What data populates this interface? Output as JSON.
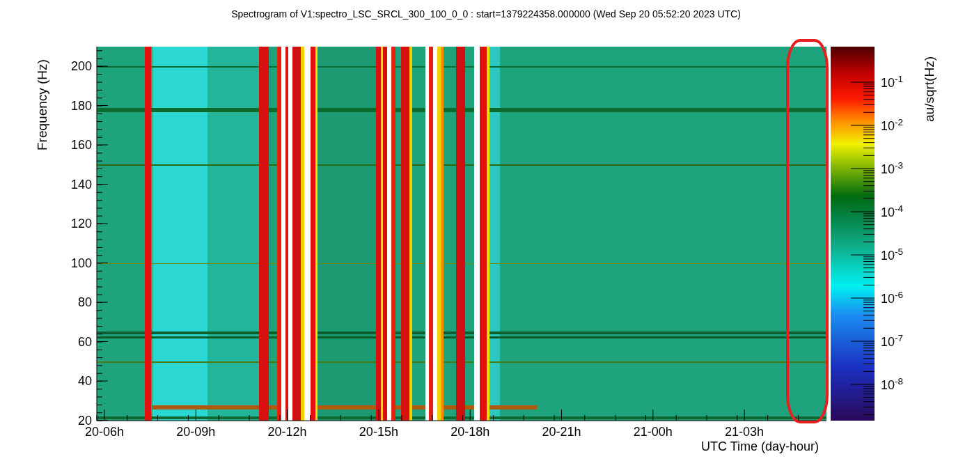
{
  "title": "Spectrogram of V1:spectro_LSC_SRCL_300_100_0_0 : start=1379224358.000000 (Wed Sep 20 05:52:20 2023 UTC)",
  "y_axis": {
    "label": "Frequency (Hz)",
    "ticks": [
      "200",
      "180",
      "160",
      "140",
      "120",
      "100",
      "80",
      "60",
      "40",
      "20"
    ]
  },
  "x_axis": {
    "label": "UTC Time (day-hour)",
    "ticks": [
      "20-06h",
      "20-09h",
      "20-12h",
      "20-15h",
      "20-18h",
      "20-21h",
      "21-00h",
      "21-03h"
    ]
  },
  "colorbar": {
    "label": "au/sqrt(Hz)",
    "ticks": [
      "10$^{-1}$",
      "10$^{-2}$",
      "10$^{-3}$",
      "10$^{-4}$",
      "10$^{-5}$",
      "10$^{-6}$",
      "10$^{-7}$",
      "10$^{-8}$"
    ]
  }
}
